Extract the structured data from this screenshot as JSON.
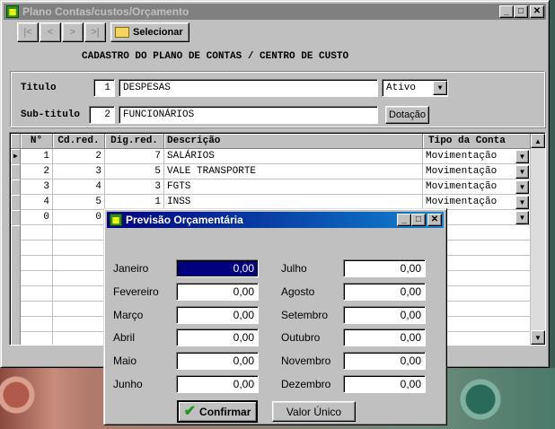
{
  "main_window": {
    "title": "Plano Contas/custos/Orçamento",
    "nav": [
      "|<",
      "<",
      ">",
      ">|"
    ],
    "select_button": "Selecionar",
    "heading": "CADASTRO DO PLANO DE CONTAS / CENTRO DE CUSTO",
    "titulo_label": "Titulo",
    "titulo_code": "1",
    "titulo_value": "DESPESAS",
    "status_value": "Ativo",
    "subtitulo_label": "Sub-titulo",
    "subtitulo_code": "2",
    "subtitulo_value": "FUNCIONÁRIOS",
    "dotacao_button": "Dotação"
  },
  "grid": {
    "columns": [
      "N°",
      "Cd.red.",
      "Dig.red.",
      "Descrição",
      "Tipo da Conta"
    ],
    "rows": [
      {
        "n": "1",
        "cd": "2",
        "dig": "7",
        "desc": "SALÁRIOS",
        "tipo": "Movimentação"
      },
      {
        "n": "2",
        "cd": "3",
        "dig": "5",
        "desc": "VALE TRANSPORTE",
        "tipo": "Movimentação"
      },
      {
        "n": "3",
        "cd": "4",
        "dig": "3",
        "desc": "FGTS",
        "tipo": "Movimentação"
      },
      {
        "n": "4",
        "cd": "5",
        "dig": "1",
        "desc": "INSS",
        "tipo": "Movimentação"
      },
      {
        "n": "0",
        "cd": "0",
        "dig": "",
        "desc": "",
        "tipo": ""
      }
    ]
  },
  "dialog": {
    "title": "Previsão Orçamentária",
    "left": [
      {
        "label": "Janeiro",
        "value": "0,00"
      },
      {
        "label": "Fevereiro",
        "value": "0,00"
      },
      {
        "label": "Março",
        "value": "0,00"
      },
      {
        "label": "Abril",
        "value": "0,00"
      },
      {
        "label": "Maio",
        "value": "0,00"
      },
      {
        "label": "Junho",
        "value": "0,00"
      }
    ],
    "right": [
      {
        "label": "Julho",
        "value": "0,00"
      },
      {
        "label": "Agosto",
        "value": "0,00"
      },
      {
        "label": "Setembro",
        "value": "0,00"
      },
      {
        "label": "Outubro",
        "value": "0,00"
      },
      {
        "label": "Novembro",
        "value": "0,00"
      },
      {
        "label": "Dezembro",
        "value": "0,00"
      }
    ],
    "confirm_button": "Confirmar",
    "single_value_button": "Valor Único"
  }
}
